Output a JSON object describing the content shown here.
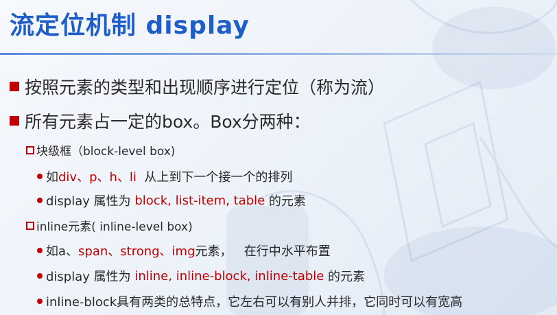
{
  "title": "流定位机制 display",
  "bullets": [
    "按照元素的类型和出现顺序进行定位（称为流）",
    "所有元素占一定的box。Box分两种："
  ],
  "block": {
    "heading": "块级框（block-level box)",
    "item1": {
      "prefix": "如",
      "red": "div、p、h、li",
      "suffix": "  从上到下一个接一个的排列"
    },
    "item2": {
      "prefix": "display 属性为 ",
      "red": "block, list-item, table",
      "suffix": " 的元素"
    }
  },
  "inline": {
    "heading": "inline元素( inline-level box)",
    "item1": {
      "prefix": "如a、",
      "red": "span、strong、img",
      "suffix": "元素，   在行中水平布置"
    },
    "item2": {
      "prefix": "display 属性为 ",
      "red": "inline, inline-block, inline-table",
      "suffix": " 的元素"
    },
    "item3": {
      "text": "inline-block具有两类的总特点，它左右可以有别人并排，它同时可以有宽高"
    }
  },
  "colors": {
    "title": "#1f5ec8",
    "bullet": "#c00000",
    "highlight": "#c00000",
    "text": "#2a2a2a"
  }
}
